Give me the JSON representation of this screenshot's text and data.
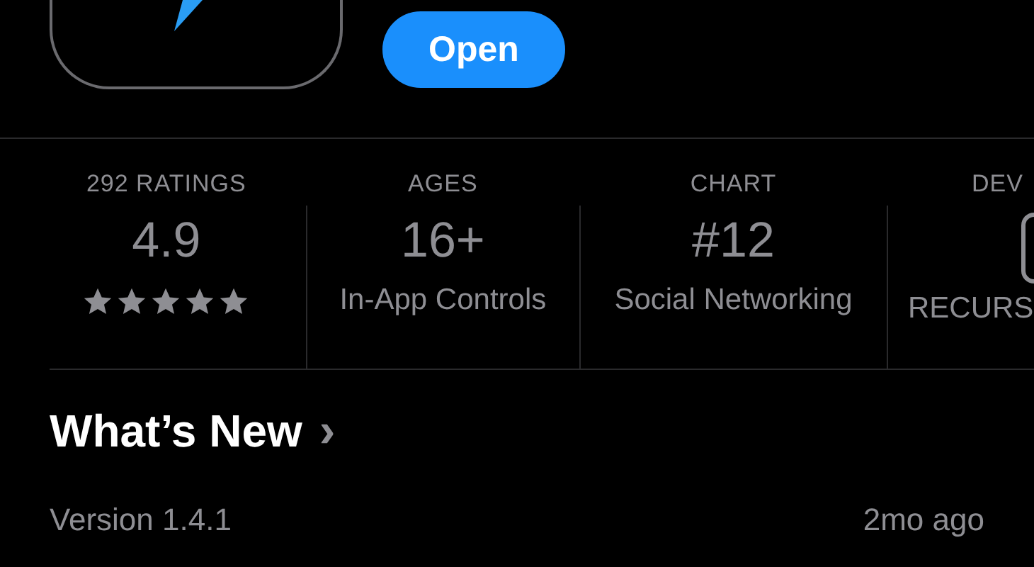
{
  "header": {
    "open_button": "Open"
  },
  "info": [
    {
      "kind": "rating",
      "title": "292 RATINGS",
      "value": "4.9",
      "stars": 5
    },
    {
      "kind": "text",
      "title": "AGES",
      "value": "16+",
      "caption": "In-App Controls"
    },
    {
      "kind": "text",
      "title": "CHART",
      "value": "#12",
      "caption": "Social Networking"
    },
    {
      "kind": "developer",
      "title": "DEV",
      "caption": "RECURS"
    }
  ],
  "whats_new": {
    "title": "What’s New",
    "chevron": "›",
    "version": "Version 1.4.1",
    "date": "2mo ago"
  }
}
